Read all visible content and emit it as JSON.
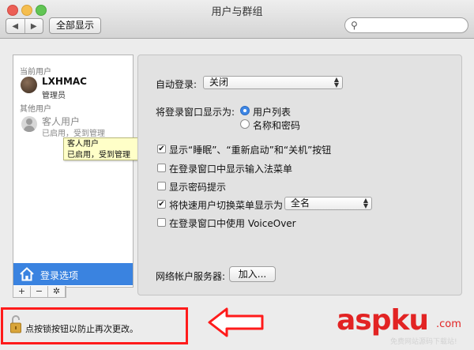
{
  "window": {
    "title": "用户与群组",
    "show_all": "全部显示",
    "nav_back": "◀",
    "nav_forward": "▶",
    "search_icon": "search-icon"
  },
  "sidebar": {
    "current_users_label": "当前用户",
    "current_user": {
      "name": "LXHMAC",
      "role": "管理员"
    },
    "other_users_label": "其他用户",
    "guest_user": {
      "name": "客人用户",
      "status": "已启用，受到管理"
    },
    "tooltip": {
      "line1": "客人用户",
      "line2": "已启用，受到管理"
    },
    "login_options": "登录选项",
    "buttons": {
      "add": "+",
      "remove": "−",
      "action": "✲"
    }
  },
  "panel": {
    "auto_login_label": "自动登录:",
    "auto_login_value": "关闭",
    "login_window_label": "将登录窗口显示为:",
    "radio_user_list": "用户列表",
    "radio_name_password": "名称和密码",
    "radio_selected": "用户列表",
    "checkboxes": [
      {
        "label": "显示“睡眠”、“重新启动”和“关机”按钮",
        "checked": true
      },
      {
        "label": "在登录窗口中显示输入法菜单",
        "checked": false
      },
      {
        "label": "显示密码提示",
        "checked": false
      },
      {
        "label": "将快速用户切换菜单显示为",
        "checked": true
      },
      {
        "label": "在登录窗口中使用 VoiceOver",
        "checked": false
      }
    ],
    "fast_switch_value": "全名",
    "network_server_label": "网络帐户服务器:",
    "join_button": "加入..."
  },
  "lock": {
    "text": "点按锁按钮以防止再次更改。"
  },
  "watermark": {
    "main": "aspku",
    "com": ".com",
    "sub": "免费网站源码下载站!"
  },
  "colors": {
    "selection_blue": "#3a83e0",
    "annotation_red": "#ff1b1b",
    "watermark_red": "#e22323"
  }
}
